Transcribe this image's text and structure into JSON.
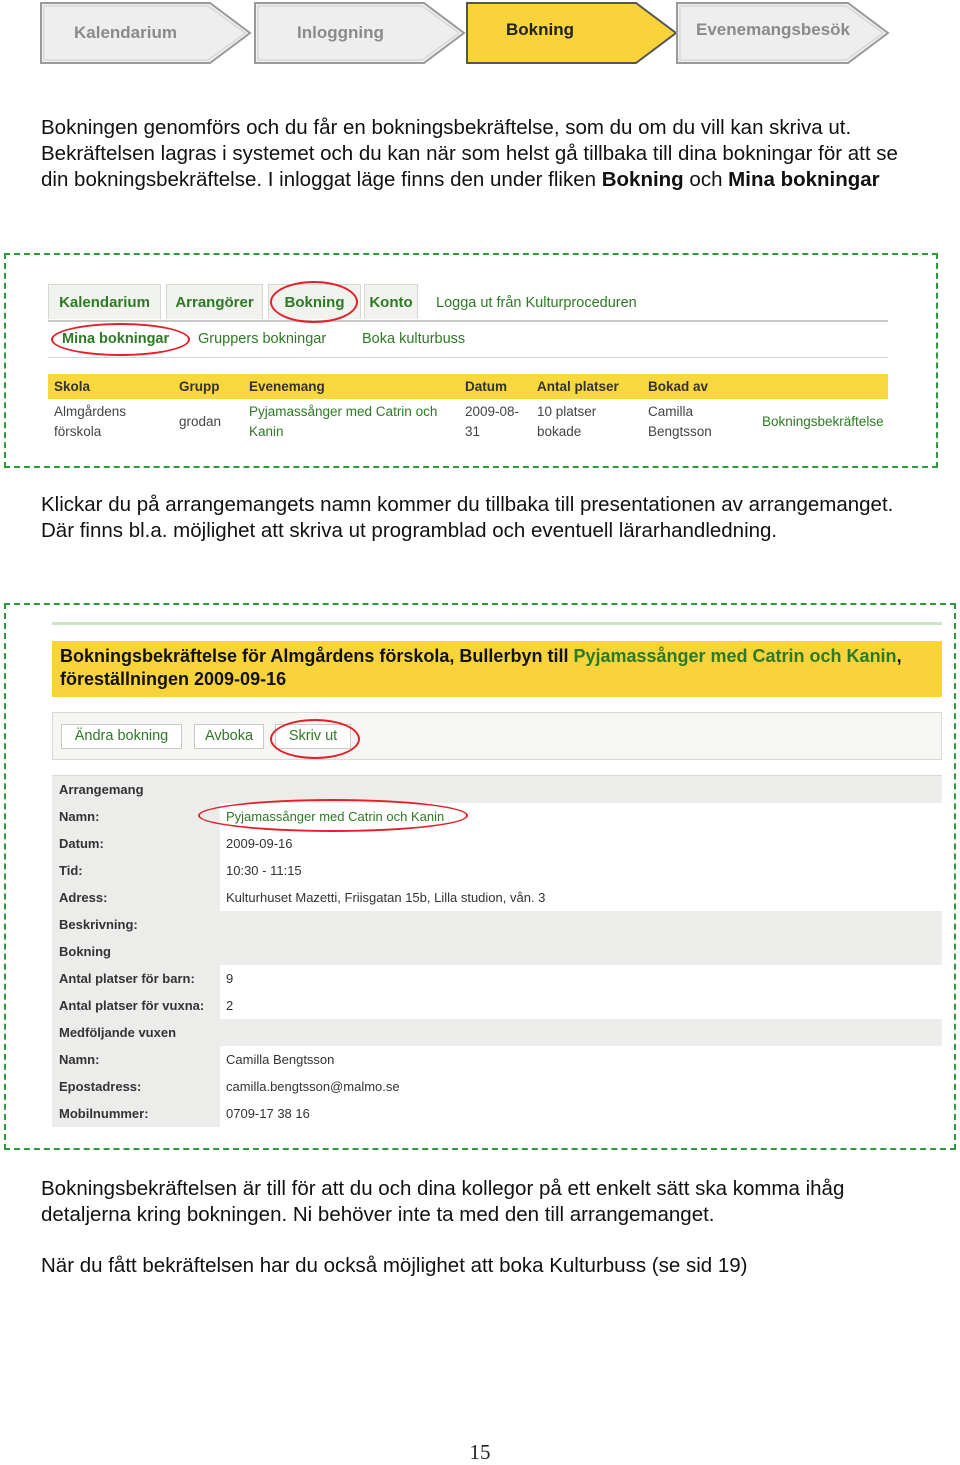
{
  "steps": [
    {
      "label": "Kalendarium",
      "active": false
    },
    {
      "label": "Inloggning",
      "active": false
    },
    {
      "label": "Bokning",
      "active": true
    },
    {
      "label": "Evenemangsbesök",
      "active": false
    }
  ],
  "colors": {
    "accent_yellow": "#f8d43a",
    "link_green": "#2d7a24",
    "dash_green": "#2e9a3a",
    "highlight_red": "#e3202a"
  },
  "intro": {
    "text": "Bokningen genomförs och du får en bokningsbekräftelse, som du om du vill kan skriva ut. Bekräftelsen lagras i systemet och du kan när som helst gå tillbaka till dina bokningar för att se din bokningsbekräftelse. I inloggat läge finns den under fliken ",
    "term1": "Bokning",
    "joiner": " och ",
    "term2": "Mina bokningar"
  },
  "shot1": {
    "tabs": [
      "Kalendarium",
      "Arrangörer",
      "Bokning",
      "Konto"
    ],
    "logout": "Logga ut från Kulturproceduren",
    "subnav": [
      "Mina bokningar",
      "Gruppers bokningar",
      "Boka kulturbuss"
    ],
    "columns": [
      "Skola",
      "Grupp",
      "Evenemang",
      "Datum",
      "Antal platser",
      "Bokad av"
    ],
    "row": {
      "skola": [
        "Almgårdens",
        "förskola"
      ],
      "grupp": "grodan",
      "evenemang": [
        "Pyjamassånger med Catrin och",
        "Kanin"
      ],
      "datum": [
        "2009-08-",
        "31"
      ],
      "platser": [
        "10 platser",
        "bokade"
      ],
      "bokad_av": [
        "Camilla",
        "Bengtsson"
      ],
      "link": "Bokningsbekräftelse"
    }
  },
  "middle": {
    "text": "Klickar du på arrangemangets namn kommer du tillbaka till presentationen av arrangemanget. Där finns bl.a. möjlighet att skriva ut programblad och eventuell lärarhandledning."
  },
  "shot2": {
    "banner": {
      "part1": "Bokningsbekräftelse för Almgårdens förskola, Bullerbyn till ",
      "event": "Pyjamassånger med Catrin och Kanin",
      "part2": ", föreställningen 2009-09-16"
    },
    "buttons": [
      "Ändra bokning",
      "Avboka",
      "Skriv ut"
    ],
    "sections": {
      "arrangemang": "Arrangemang",
      "bokning": "Bokning",
      "vuxen": "Medföljande vuxen"
    },
    "labels": {
      "namn": "Namn:",
      "datum": "Datum:",
      "tid": "Tid:",
      "adress": "Adress:",
      "beskrivning": "Beskrivning:",
      "barn": "Antal platser för barn:",
      "vuxna": "Antal platser för vuxna:",
      "namn2": "Namn:",
      "epost": "Epostadress:",
      "mobil": "Mobilnummer:"
    },
    "values": {
      "namn": "Pyjamassånger med Catrin och Kanin",
      "datum": "2009-09-16",
      "tid": "10:30 - 11:15",
      "adress": "Kulturhuset Mazetti, Friisgatan 15b, Lilla studion, vån. 3",
      "beskrivning": "",
      "barn": "9",
      "vuxna": "2",
      "namn2": "Camilla Bengtsson",
      "epost": "camilla.bengtsson@malmo.se",
      "mobil": "0709-17 38 16"
    }
  },
  "closing": {
    "p1": "Bokningsbekräftelsen är till för att du och dina kollegor på ett enkelt sätt ska komma ihåg detaljerna kring bokningen. Ni behöver inte ta med den till arrangemanget.",
    "p2": "När du fått bekräftelsen har du också möjlighet att boka Kulturbuss (se sid 19)"
  },
  "page_number": "15"
}
